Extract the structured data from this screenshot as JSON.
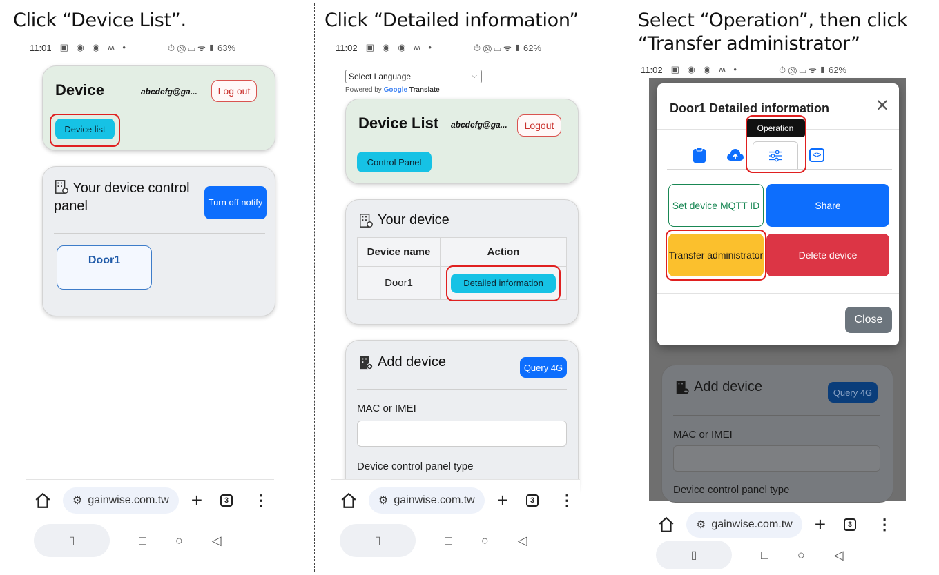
{
  "steps": [
    {
      "caption": "Click “Device List”.",
      "status": {
        "time": "11:01",
        "battery": "63%"
      },
      "card": {
        "title": "Device",
        "email": "abcdefg@ga...",
        "logout": "Log out",
        "device_list_btn": "Device list"
      },
      "panel": {
        "title": "Your device control panel",
        "notify_btn": "Turn off notify",
        "door": "Door1"
      },
      "browser": {
        "url": "gainwise.com.tw",
        "tabs": "3"
      }
    },
    {
      "caption": "Click “Detailed information”",
      "status": {
        "time": "11:02",
        "battery": "62%"
      },
      "language": {
        "select": "Select Language",
        "powered_by": "Powered by",
        "google": "Google",
        "translate": "Translate"
      },
      "card": {
        "title": "Device List",
        "email": "abcdefg@ga...",
        "logout": "Logout",
        "control_panel_btn": "Control Panel"
      },
      "your_device": {
        "title": "Your device",
        "headers": [
          "Device name",
          "Action"
        ],
        "row": {
          "name": "Door1",
          "action": "Detailed information"
        }
      },
      "add_device": {
        "title": "Add device",
        "query_btn": "Query 4G",
        "mac_label": "MAC or IMEI",
        "type_label": "Device control panel type"
      },
      "browser": {
        "url": "gainwise.com.tw",
        "tabs": "3"
      }
    },
    {
      "caption_line1": "Select “Operation”, then click",
      "caption_line2": "“Transfer administrator”",
      "status": {
        "time": "11:02",
        "battery": "62%"
      },
      "modal": {
        "title": "Door1 Detailed information",
        "tooltip": "Operation",
        "set_mqtt": "Set device MQTT ID",
        "share": "Share",
        "transfer": "Transfer administrator",
        "delete": "Delete device",
        "close": "Close"
      },
      "add_device": {
        "title": "Add device",
        "query_btn": "Query 4G",
        "mac_label": "MAC or IMEI",
        "type_label": "Device control panel type"
      },
      "browser": {
        "url": "gainwise.com.tw",
        "tabs": "3"
      }
    }
  ]
}
